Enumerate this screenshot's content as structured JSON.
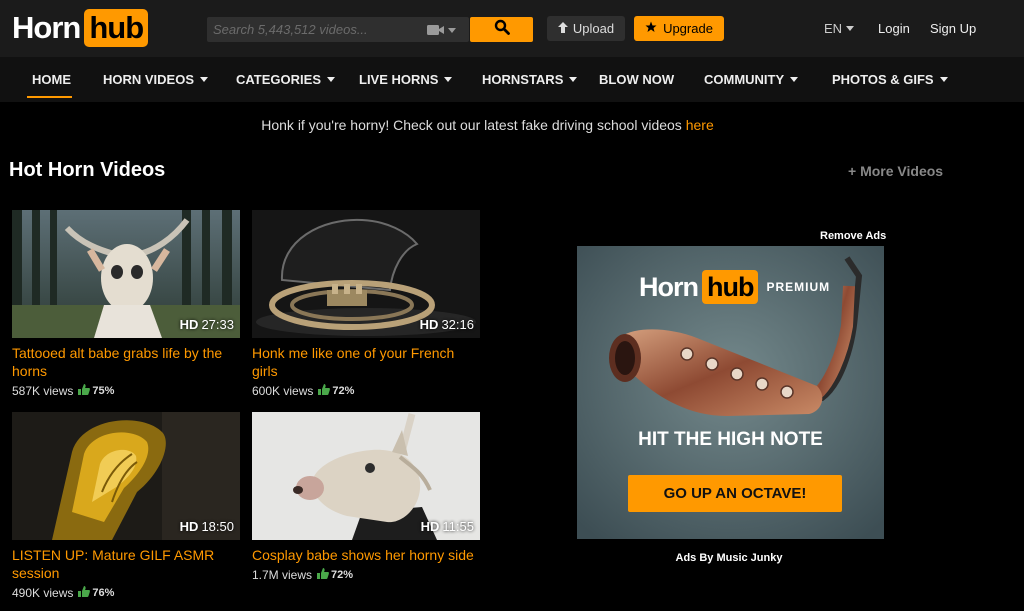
{
  "brand": {
    "logo_left": "Horn",
    "logo_right": "hub",
    "accent": "#ff9900"
  },
  "header": {
    "search_placeholder": "Search 5,443,512 videos...",
    "upload_label": "Upload",
    "upgrade_label": "Upgrade",
    "language": "EN",
    "login_label": "Login",
    "signup_label": "Sign Up"
  },
  "nav": {
    "items": [
      {
        "label": "HOME"
      },
      {
        "label": "HORN VIDEOS"
      },
      {
        "label": "CATEGORIES"
      },
      {
        "label": "LIVE HORNS"
      },
      {
        "label": "HORNSTARS"
      },
      {
        "label": "BLOW NOW"
      },
      {
        "label": "COMMUNITY"
      },
      {
        "label": "PHOTOS & GIFS"
      }
    ]
  },
  "notice": {
    "text": "Honk if you're horny! Check out our latest fake driving school videos ",
    "link": "here"
  },
  "section": {
    "title": "Hot Horn Videos",
    "more": "More Videos"
  },
  "videos": [
    {
      "title": "Tattooed alt babe grabs life by the horns",
      "duration": "27:33",
      "quality": "HD",
      "views": "587K views",
      "rating": "75%"
    },
    {
      "title": "Honk me like one of your French girls",
      "duration": "32:16",
      "quality": "HD",
      "views": "600K views",
      "rating": "72%"
    },
    {
      "title": "LISTEN UP: Mature GILF ASMR session",
      "duration": "18:50",
      "quality": "HD",
      "views": "490K views",
      "rating": "76%"
    },
    {
      "title": "Cosplay babe shows her horny side",
      "duration": "11:55",
      "quality": "HD",
      "views": "1.7M views",
      "rating": "72%"
    }
  ],
  "ad": {
    "remove_ads": "Remove Ads",
    "logo_left": "Horn",
    "logo_right": "hub",
    "premium": "PREMIUM",
    "headline": "HIT THE HIGH NOTE",
    "cta": "GO UP AN OCTAVE!",
    "by": "Ads By Music Junky"
  }
}
